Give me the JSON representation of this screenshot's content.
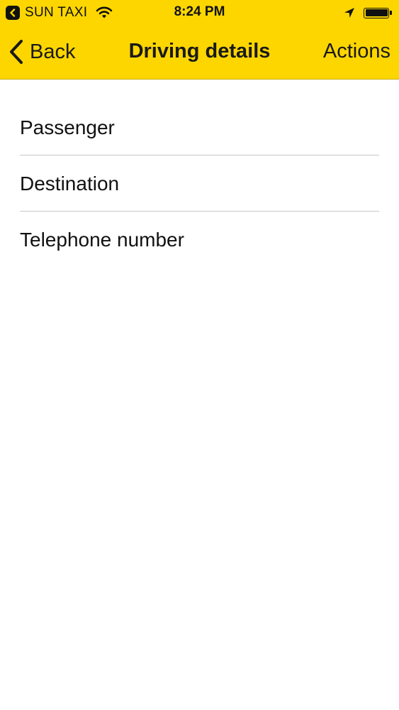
{
  "status_bar": {
    "back_app_label": "SUN TAXI",
    "time": "8:24 PM",
    "battery_level": 1.0,
    "icons": [
      "back-arrow-icon",
      "wifi-icon",
      "location-arrow-icon",
      "battery-icon"
    ]
  },
  "nav": {
    "back_label": "Back",
    "title": "Driving details",
    "actions_label": "Actions",
    "back_icon": "chevron-left-icon"
  },
  "details": {
    "rows": [
      {
        "label": "Passenger"
      },
      {
        "label": "Destination"
      },
      {
        "label": "Telephone number"
      }
    ]
  },
  "colors": {
    "header_background": "#fdd600",
    "text": "#111111",
    "separator": "#c8c8cc",
    "page_background": "#ffffff"
  }
}
